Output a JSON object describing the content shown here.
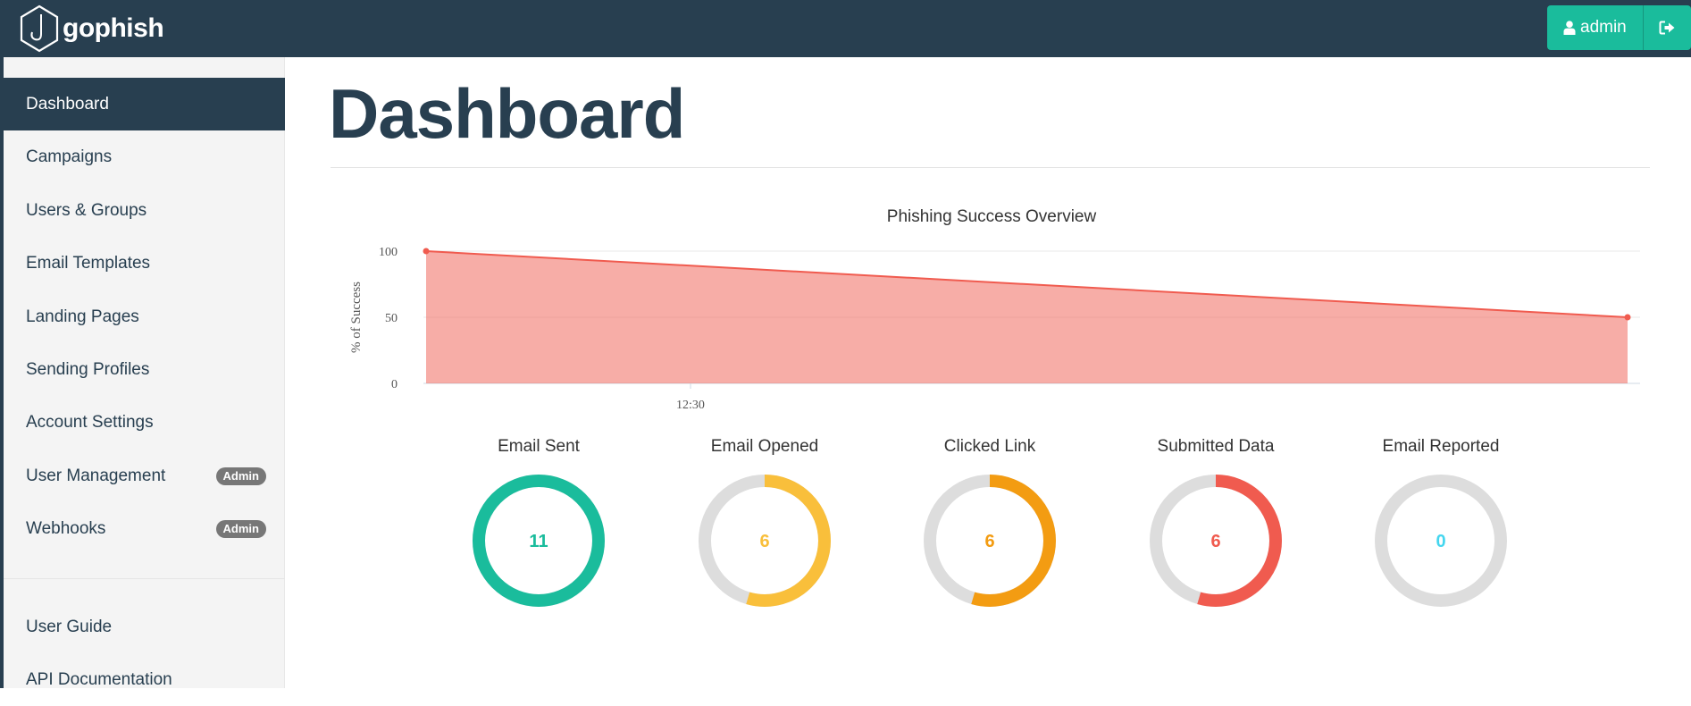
{
  "header": {
    "brand": "gophish",
    "user_label": "admin",
    "colors": {
      "navbar": "#283F50",
      "accent": "#1abc9c"
    }
  },
  "sidebar": {
    "items": [
      {
        "label": "Dashboard",
        "active": true
      },
      {
        "label": "Campaigns"
      },
      {
        "label": "Users & Groups"
      },
      {
        "label": "Email Templates"
      },
      {
        "label": "Landing Pages"
      },
      {
        "label": "Sending Profiles"
      },
      {
        "label": "Account Settings"
      },
      {
        "label": "User Management",
        "badge": "Admin"
      },
      {
        "label": "Webhooks",
        "badge": "Admin"
      }
    ],
    "footer_items": [
      {
        "label": "User Guide"
      },
      {
        "label": "API Documentation"
      }
    ]
  },
  "main": {
    "title": "Dashboard"
  },
  "chart_data": {
    "type": "area",
    "title": "Phishing Success Overview",
    "ylabel": "% of Success",
    "xlabel": "",
    "x_tick_labels": [
      "12:30"
    ],
    "y_ticks": [
      0,
      50,
      100
    ],
    "ylim": [
      0,
      100
    ],
    "grid": true,
    "color": "#f05b4f",
    "series": [
      {
        "values": [
          100,
          50
        ]
      }
    ]
  },
  "stats": [
    {
      "label": "Email Sent",
      "value": "11",
      "fraction": 1.0,
      "color": "#1abc9c"
    },
    {
      "label": "Email Opened",
      "value": "6",
      "fraction": 0.545,
      "color": "#f9bf3b"
    },
    {
      "label": "Clicked Link",
      "value": "6",
      "fraction": 0.545,
      "color": "#f39c12"
    },
    {
      "label": "Submitted Data",
      "value": "6",
      "fraction": 0.545,
      "color": "#f05b4f"
    },
    {
      "label": "Email Reported",
      "value": "0",
      "fraction": 0,
      "color": "#45d6ef"
    }
  ]
}
